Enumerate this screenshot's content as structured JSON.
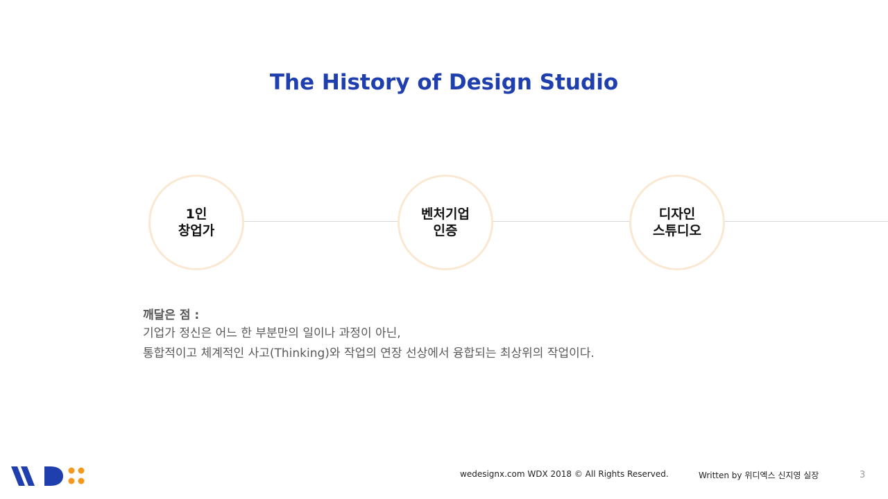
{
  "slide": {
    "title": "The History of Design Studio"
  },
  "timeline": {
    "milestones": [
      {
        "line1": "1인",
        "line2": "창업가"
      },
      {
        "line1": "벤처기업",
        "line2": "인증"
      },
      {
        "line1": "디자인",
        "line2": "스튜디오"
      }
    ]
  },
  "insight": {
    "heading": "깨달은 점 :",
    "line1": "기업가 정신은 어느 한 부분만의 일이나 과정이 아닌,",
    "line2": "통합적이고 체계적인 사고(Thinking)와 작업의 연장 선상에서 융합되는 최상위의 작업이다."
  },
  "footer": {
    "copyright": "wedesignx.com  WDX  2018  ©  All  Rights  Reserved.",
    "author": "Written  by  위디엑스  신지영  실장",
    "page_number": "3"
  },
  "colors": {
    "title": "#1f3fae",
    "logo_blue": "#1f3fae",
    "logo_orange": "#f39a1e",
    "circle_border": "#fbe8d2"
  }
}
